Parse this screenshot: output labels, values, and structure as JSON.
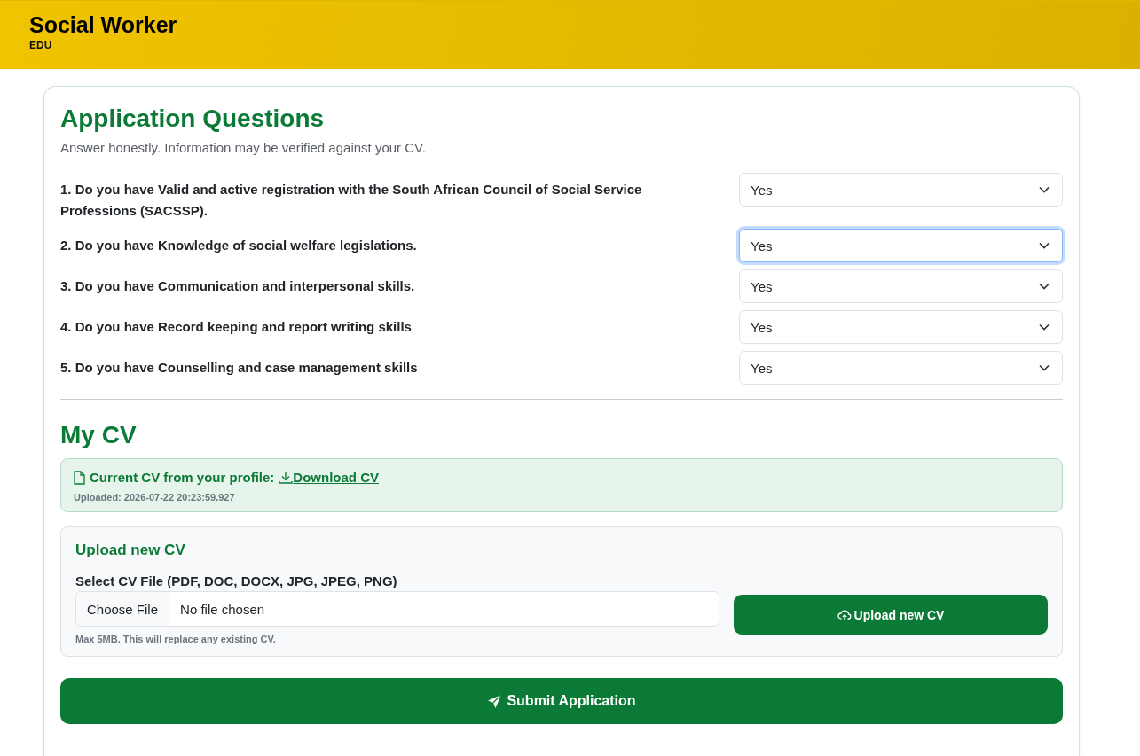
{
  "header": {
    "title": "Social Worker",
    "subtitle": "EDU"
  },
  "questions_section": {
    "title": "Application Questions",
    "intro": "Answer honestly. Information may be verified against your CV.",
    "questions": [
      {
        "label": "1. Do you have Valid and active registration with the South African Council of Social Service Professions (SACSSP).",
        "answer": "Yes",
        "focused": false
      },
      {
        "label": "2. Do you have Knowledge of social welfare legislations.",
        "answer": "Yes",
        "focused": true
      },
      {
        "label": "3. Do you have Communication and interpersonal skills.",
        "answer": "Yes",
        "focused": false
      },
      {
        "label": "4. Do you have Record keeping and report writing skills",
        "answer": "Yes",
        "focused": false
      },
      {
        "label": "5. Do you have Counselling and case management skills",
        "answer": "Yes",
        "focused": false
      }
    ]
  },
  "cv_section": {
    "title": "My CV",
    "current": {
      "label": "Current CV from your profile:",
      "link": "Download CV",
      "uploaded": "Uploaded: 2026-07-22 20:23:59.927"
    },
    "upload": {
      "title": "Upload new CV",
      "field_label": "Select CV File (PDF, DOC, DOCX, JPG, JPEG, PNG)",
      "choose_button": "Choose File",
      "file_status": "No file chosen",
      "hint": "Max 5MB. This will replace any existing CV.",
      "button": "Upload new CV"
    }
  },
  "submit_button": "Submit Application"
}
